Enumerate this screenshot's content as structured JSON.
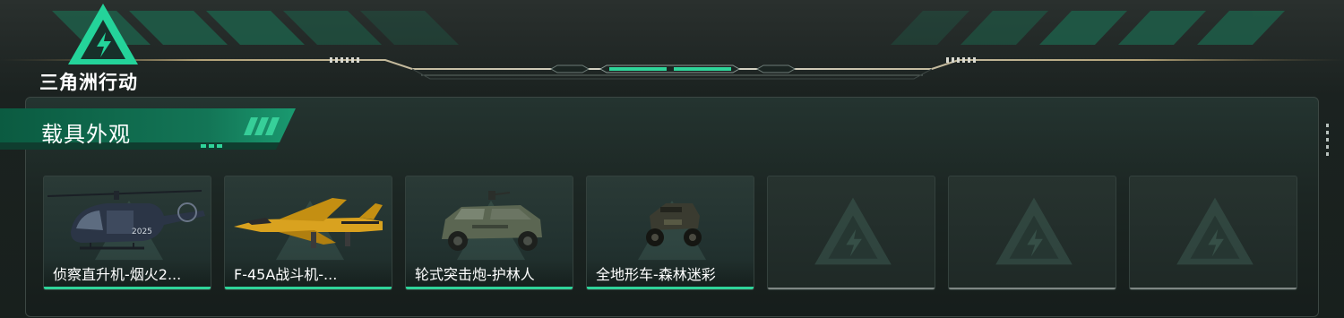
{
  "header": {
    "logo_text": "三角洲行动",
    "logo_icon": "delta-triangle-logo"
  },
  "section": {
    "title": "载具外观"
  },
  "cards": [
    {
      "label": "侦察直升机-烟火2...",
      "vehicle_icon": "helicopter-icon",
      "filled": true
    },
    {
      "label": "F-45A战斗机-...",
      "vehicle_icon": "fighter-jet-icon",
      "filled": true
    },
    {
      "label": "轮式突击炮-护林人",
      "vehicle_icon": "armored-car-icon",
      "filled": true
    },
    {
      "label": "全地形车-森林迷彩",
      "vehicle_icon": "atv-icon",
      "filled": true
    },
    {
      "label": "",
      "vehicle_icon": "empty-slot-icon",
      "filled": false
    },
    {
      "label": "",
      "vehicle_icon": "empty-slot-icon",
      "filled": false
    },
    {
      "label": "",
      "vehicle_icon": "empty-slot-icon",
      "filled": false
    }
  ],
  "colors": {
    "accent": "#2fd49a",
    "panel_bg": "#1c2623",
    "empty_underline": "#7f8784"
  }
}
